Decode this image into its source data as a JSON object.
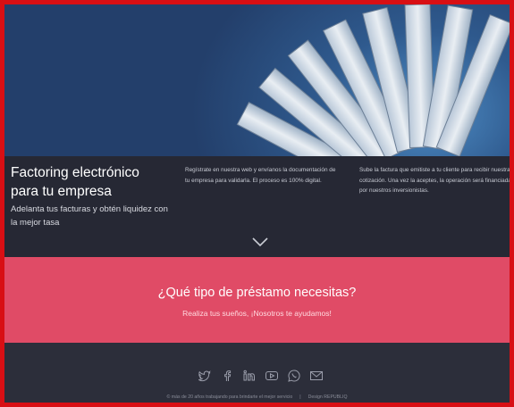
{
  "info": {
    "title_line1": "Factoring electrónico",
    "title_line2": "para tu empresa",
    "subtitle": "Adelanta tus facturas y obtén liquidez con la mejor tasa",
    "col1_text": "Regístrate en nuestra web y envíanos la documentación de tu empresa para validarla. El proceso es 100% digital.",
    "col2_text": "Sube la factura que emitiste a tu cliente para recibir nuestra cotización. Una vez la aceptes, la operación será financiada por nuestros inversionistas."
  },
  "loan": {
    "title": "¿Qué tipo de préstamo necesitas?",
    "subtitle": "Realiza tus sueños, ¡Nosotros te ayudamos!"
  },
  "footer": {
    "left_text": "© más de 20 años trabajando para brindarte el mejor servicio",
    "separator": "|",
    "right_text": "Design REPUBLIQ",
    "social": [
      "twitter-icon",
      "facebook-icon",
      "linkedin-icon",
      "youtube-icon",
      "whatsapp-icon",
      "mail-icon"
    ]
  },
  "colors": {
    "frame": "#d80f14",
    "hero_blue": "#2f5a8e",
    "info_bg": "#262834",
    "pink": "#e04b66",
    "footer_bg": "#2c2e3a"
  }
}
